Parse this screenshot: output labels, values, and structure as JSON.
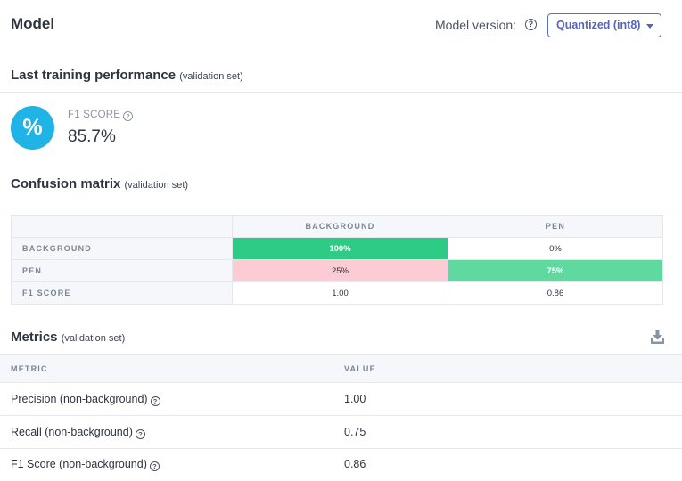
{
  "header": {
    "title": "Model",
    "version_label": "Model version:",
    "version_selected": "Quantized (int8)"
  },
  "performance": {
    "title": "Last training performance",
    "subtitle": "(validation set)",
    "badge_symbol": "%",
    "f1_label": "F1 SCORE",
    "f1_value": "85.7%"
  },
  "confusion": {
    "title": "Confusion matrix",
    "subtitle": "(validation set)",
    "columns": [
      "BACKGROUND",
      "PEN"
    ],
    "rows": [
      {
        "label": "BACKGROUND",
        "cells": [
          "100%",
          "0%"
        ]
      },
      {
        "label": "PEN",
        "cells": [
          "25%",
          "75%"
        ]
      },
      {
        "label": "F1 SCORE",
        "cells": [
          "1.00",
          "0.86"
        ]
      }
    ],
    "colors": {
      "strong_green": "#2ecb86",
      "light_green": "#5fd9a0",
      "pink": "#fccbd4"
    }
  },
  "metrics": {
    "title": "Metrics",
    "subtitle": "(validation set)",
    "download_icon": "download-icon",
    "col_metric": "METRIC",
    "col_value": "VALUE",
    "rows": [
      {
        "name": "Precision (non-background)",
        "value": "1.00"
      },
      {
        "name": "Recall (non-background)",
        "value": "0.75"
      },
      {
        "name": "F1 Score (non-background)",
        "value": "0.86"
      }
    ]
  },
  "accent_color": "#5563c1",
  "help_icon": "question-circle-icon"
}
